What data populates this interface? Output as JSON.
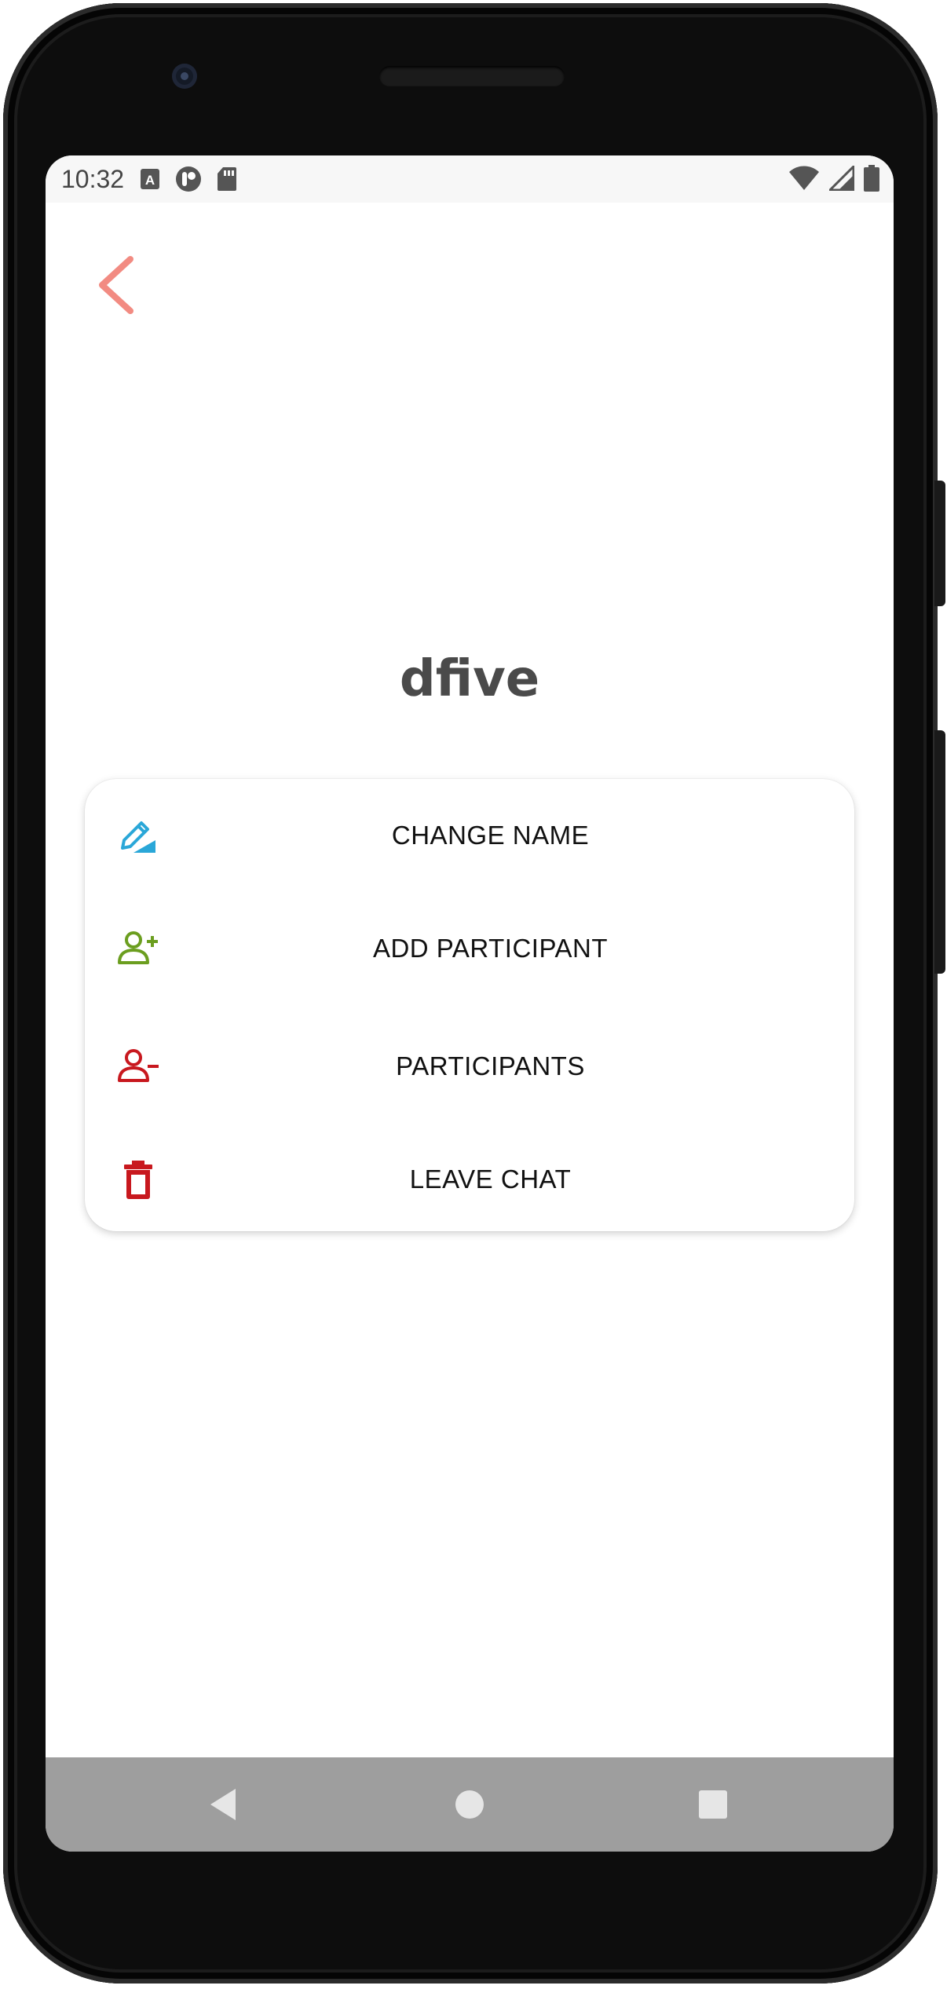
{
  "status_bar": {
    "time": "10:32",
    "left_icons": [
      "a-badge-icon",
      "circle-app-icon",
      "sd-card-icon"
    ],
    "right_icons": [
      "wifi-icon",
      "cell-signal-icon",
      "battery-icon"
    ]
  },
  "header": {
    "back_icon": "chevron-left-icon",
    "back_color": "#f28b82"
  },
  "chat": {
    "title": "dfive"
  },
  "menu": {
    "items": [
      {
        "label": "CHANGE NAME",
        "icon": "edit-icon",
        "color": "#2aa7d8"
      },
      {
        "label": "ADD PARTICIPANT",
        "icon": "add-person-icon",
        "color": "#6b9e1f"
      },
      {
        "label": "PARTICIPANTS",
        "icon": "remove-person-icon",
        "color": "#c8181e"
      },
      {
        "label": "LEAVE CHAT",
        "icon": "trash-icon",
        "color": "#c8181e"
      }
    ]
  },
  "nav_bar": {
    "buttons": [
      "back-triangle-icon",
      "home-circle-icon",
      "recents-square-icon"
    ]
  }
}
